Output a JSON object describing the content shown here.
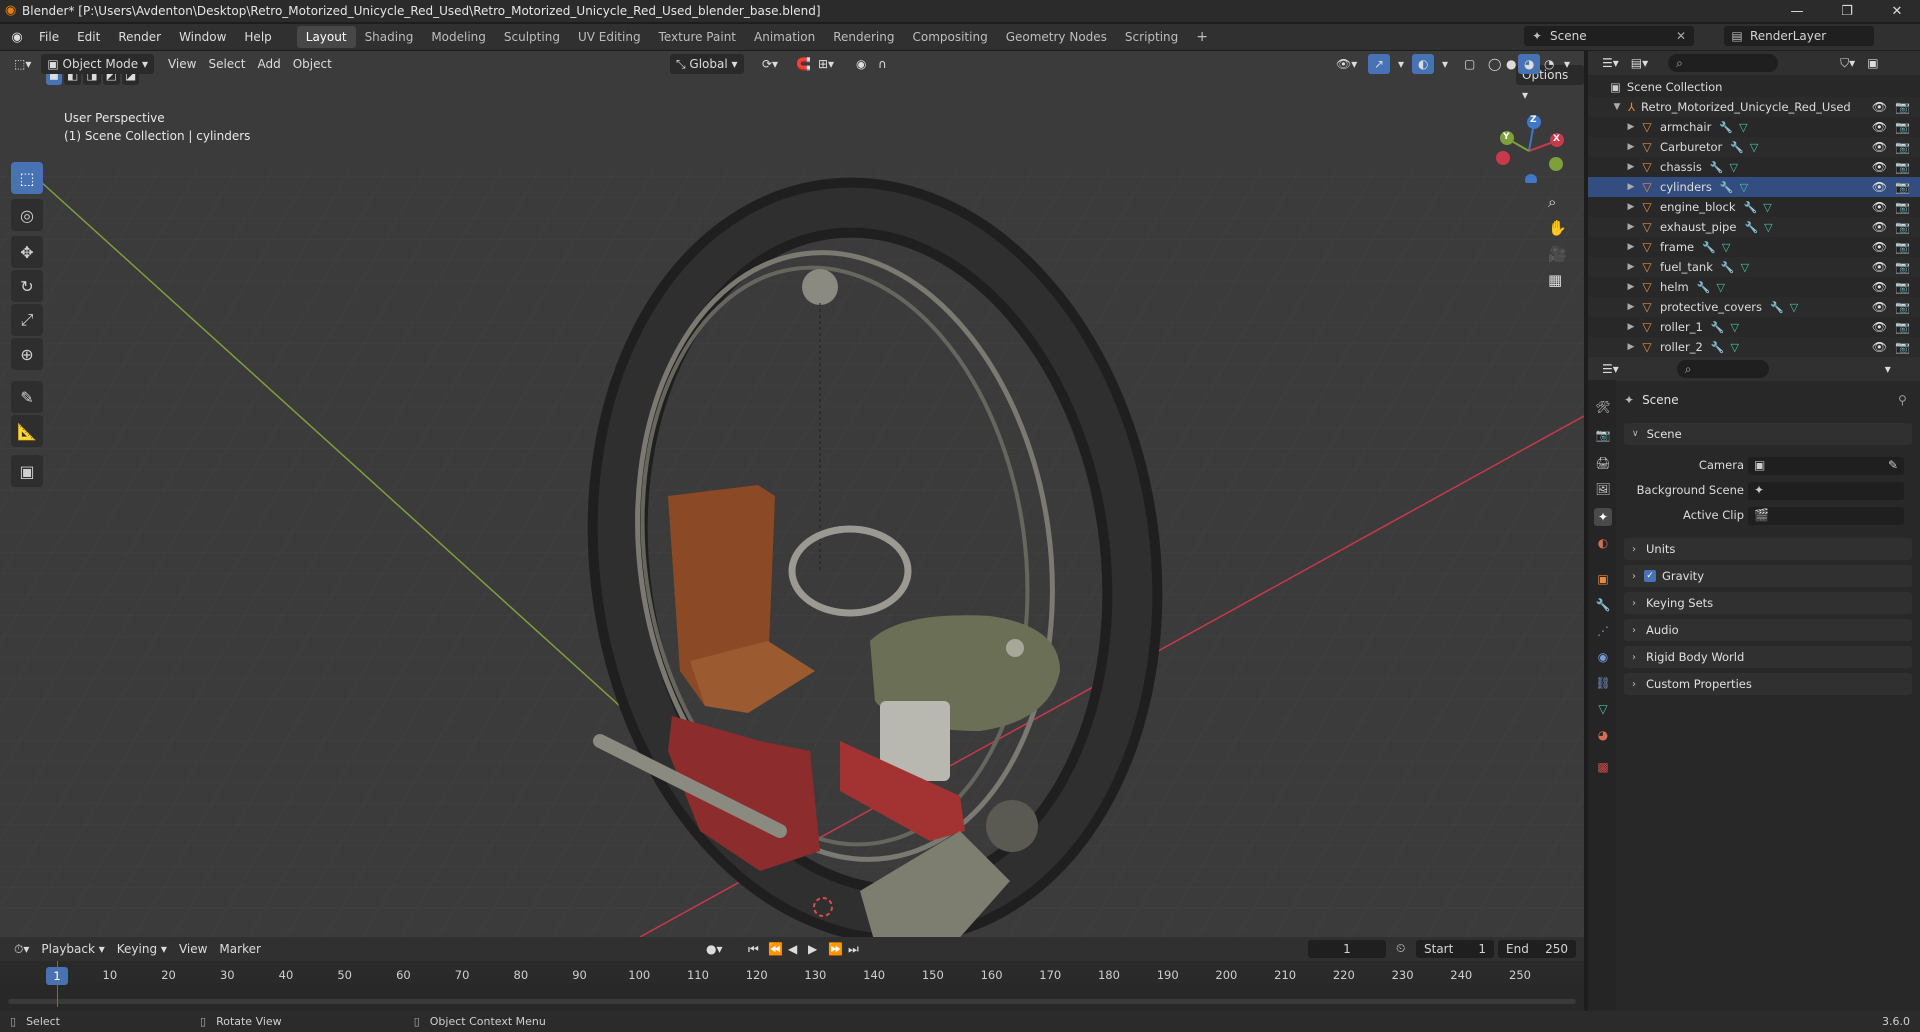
{
  "title_bar": {
    "title": "Blender* [P:\\Users\\Avdenton\\Desktop\\Retro_Motorized_Unicycle_Red_Used\\Retro_Motorized_Unicycle_Red_Used_blender_base.blend]",
    "minimize": "—",
    "maximize": "❐",
    "close": "✕"
  },
  "menu": {
    "items": [
      "File",
      "Edit",
      "Render",
      "Window",
      "Help"
    ]
  },
  "workspaces": {
    "tabs": [
      "Layout",
      "Shading",
      "Modeling",
      "Sculpting",
      "UV Editing",
      "Texture Paint",
      "Animation",
      "Rendering",
      "Compositing",
      "Geometry Nodes",
      "Scripting"
    ],
    "active": "Layout",
    "add": "+"
  },
  "scene_selector": {
    "scene": "Scene",
    "view_layer": "RenderLayer"
  },
  "viewport": {
    "mode": "Object Mode",
    "menus": [
      "View",
      "Select",
      "Add",
      "Object"
    ],
    "transform_orientation": "Global",
    "options": "Options",
    "overlay_line1": "User Perspective",
    "overlay_line2": "(1) Scene Collection | cylinders",
    "gizmo_axes": {
      "z": "Z",
      "y": "Y",
      "x": "X"
    },
    "colors": {
      "x_axis": "#c8394a",
      "y_axis": "#7ea03a",
      "z_axis": "#3f78c7",
      "accent": "#4772b3"
    }
  },
  "outliner": {
    "root": "Scene Collection",
    "collection": "Retro_Motorized_Unicycle_Red_Used",
    "objects": [
      "armchair",
      "Carburetor",
      "chassis",
      "cylinders",
      "engine_block",
      "exhaust_pipe",
      "frame",
      "fuel_tank",
      "helm",
      "protective_covers",
      "roller_1",
      "roller_2"
    ],
    "selected": "cylinders"
  },
  "properties": {
    "context": "Scene",
    "panel_open": "Scene",
    "fields": [
      {
        "label": "Camera",
        "value": ""
      },
      {
        "label": "Background Scene",
        "value": ""
      },
      {
        "label": "Active Clip",
        "value": ""
      }
    ],
    "collapsed_panels": [
      "Units",
      "Gravity",
      "Keying Sets",
      "Audio",
      "Rigid Body World",
      "Custom Properties"
    ],
    "gravity_checked": true
  },
  "timeline": {
    "menus": [
      "Playback",
      "Keying",
      "View",
      "Marker"
    ],
    "current_frame": "1",
    "start_label": "Start",
    "start": "1",
    "end_label": "End",
    "end": "250",
    "ruler": [
      "1",
      "10",
      "20",
      "30",
      "40",
      "50",
      "60",
      "70",
      "80",
      "90",
      "100",
      "110",
      "120",
      "130",
      "140",
      "150",
      "160",
      "170",
      "180",
      "190",
      "200",
      "210",
      "220",
      "230",
      "240",
      "250"
    ]
  },
  "status_bar": {
    "select": "Select",
    "rotate": "Rotate View",
    "context_menu": "Object Context Menu",
    "version": "3.6.0"
  }
}
